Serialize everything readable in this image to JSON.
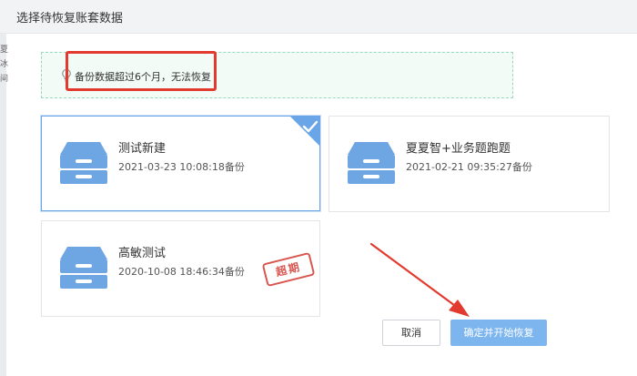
{
  "dialog": {
    "title": "选择待恢复账套数据"
  },
  "tip": {
    "text": "备份数据超过6个月，无法恢复",
    "icon": "lightbulb-icon"
  },
  "edge": {
    "chars": [
      "夏",
      "冰",
      "间"
    ]
  },
  "cards": [
    {
      "name": "测试新建",
      "time": "2021-03-23 10:08:18备份",
      "selected": true
    },
    {
      "name": "夏夏智+业务题跑题",
      "time": "2021-02-21 09:35:27备份",
      "selected": false
    },
    {
      "name": "高敏测试",
      "time": "2020-10-08 18:46:34备份",
      "selected": false,
      "stamp": "超期"
    }
  ],
  "buttons": {
    "cancel": "取消",
    "confirm": "确定并开始恢复"
  },
  "colors": {
    "accent": "#6aa5e8",
    "confirm": "#7db6ef",
    "highlight": "#e23a2e",
    "tip_bg": "#f2fbf6",
    "stamp": "#d9554f"
  }
}
